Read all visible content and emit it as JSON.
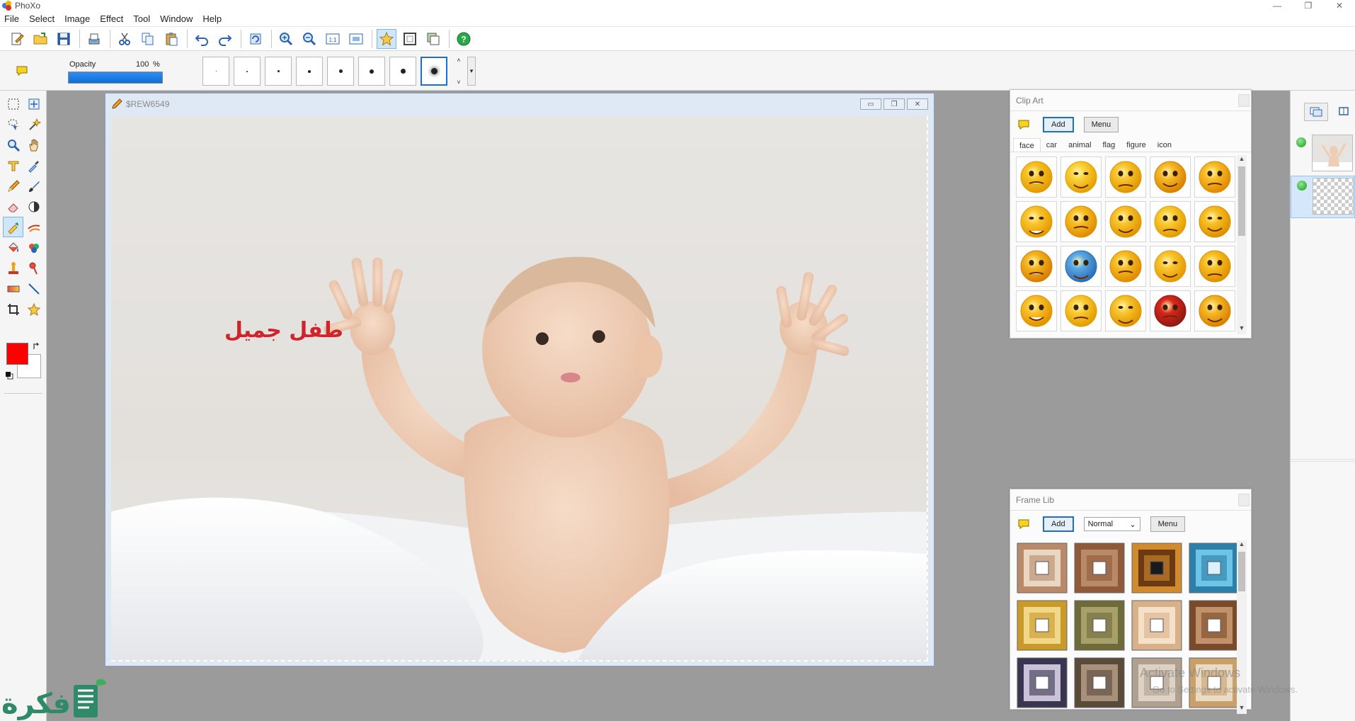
{
  "app": {
    "title": "PhoXo"
  },
  "window_controls": {
    "minimize": "—",
    "maximize": "❐",
    "close": "✕"
  },
  "menu": [
    "File",
    "Select",
    "Image",
    "Effect",
    "Tool",
    "Window",
    "Help"
  ],
  "toolbar": {
    "buttons": [
      "new-icon",
      "open-icon",
      "save-icon",
      "scan-icon",
      "cut-icon",
      "copy-icon",
      "paste-icon",
      "undo-icon",
      "redo-icon",
      "refresh-icon",
      "zoom-in-icon",
      "zoom-out-icon",
      "actual-size-icon",
      "fit-window-icon",
      "favorite-star-icon",
      "frame-icon",
      "layers-icon",
      "help-icon"
    ],
    "actual_size_label": "1:1",
    "help_label": "?"
  },
  "options": {
    "opacity_label": "Opacity",
    "opacity_value": "100",
    "opacity_unit": "%",
    "opacity_fraction": 1.0,
    "brush_sizes": [
      1,
      2,
      3,
      4,
      5,
      6,
      7,
      9
    ],
    "selected_brush_index": 7,
    "scroll_up": "˄",
    "scroll_down": "˅",
    "more": "▾"
  },
  "colors": {
    "primary": "#ff0000",
    "secondary": "#ffffff",
    "accent": "#1c6fd0"
  },
  "image_window": {
    "title": "$REW6549",
    "canvas_text": "طفل جميل",
    "buttons": [
      "▭",
      "❐",
      "✕"
    ]
  },
  "clipart": {
    "title": "Clip Art",
    "add_label": "Add",
    "menu_label": "Menu",
    "tabs": [
      "face",
      "car",
      "animal",
      "flag",
      "figure",
      "icon"
    ],
    "selected_tab": "face",
    "items_count": 20
  },
  "framelib": {
    "title": "Frame Lib",
    "add_label": "Add",
    "mode_value": "Normal",
    "menu_label": "Menu",
    "frames_count": 12
  },
  "watermark": {
    "line1": "Activate Windows",
    "line2": "Go to Settings to activate Windows.",
    "logo_text": "فكرة"
  }
}
